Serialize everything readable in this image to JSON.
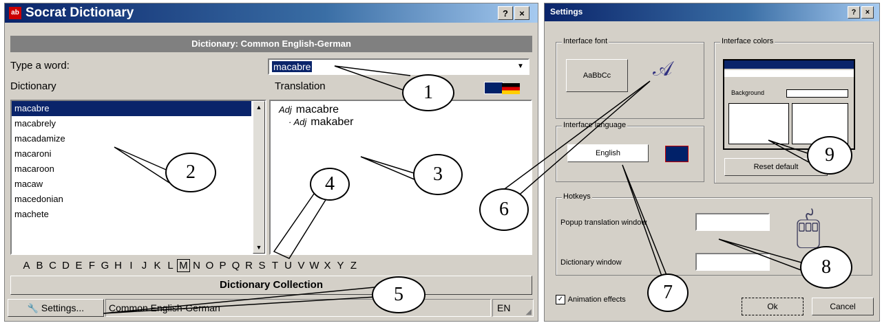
{
  "dictionary_window": {
    "title": "Socrat Dictionary",
    "help_button": "?",
    "close_button": "×",
    "header": "Dictionary: Common English-German",
    "type_word_label": "Type a word:",
    "word_input_value": "macabre",
    "dictionary_label": "Dictionary",
    "translation_label": "Translation",
    "word_list": [
      "macabre",
      "macabrely",
      "macadamize",
      "macaroni",
      "macaroon",
      "macaw",
      "macedonian",
      "machete"
    ],
    "translation_lines": [
      {
        "pos": "Adj",
        "text": "macabre"
      },
      {
        "pos": "· Adj",
        "text": "makaber"
      }
    ],
    "alphabet": [
      "A",
      "B",
      "C",
      "D",
      "E",
      "F",
      "G",
      "H",
      "I",
      "J",
      "K",
      "L",
      "M",
      "N",
      "O",
      "P",
      "Q",
      "R",
      "S",
      "T",
      "U",
      "V",
      "W",
      "X",
      "Y",
      "Z"
    ],
    "alphabet_selected": "M",
    "collection_button": "Dictionary Collection",
    "settings_button": "Settings...",
    "status_dictionary": "Common English-German",
    "status_lang": "EN"
  },
  "settings_window": {
    "title": "Settings",
    "help_button": "?",
    "close_button": "×",
    "interface_font_label": "Interface font",
    "font_sample": "AaBbCc",
    "interface_colors_label": "Interface colors",
    "colors_preview_background": "Background",
    "reset_button": "Reset default",
    "interface_language_label": "Interface language",
    "language_value": "English",
    "hotkeys_label": "Hotkeys",
    "popup_window_label": "Popup translation window",
    "dictionary_window_label": "Dictionary window",
    "animation_label": "Animation effects",
    "animation_checked": true,
    "ok_button": "Ok",
    "cancel_button": "Cancel"
  },
  "callouts": [
    "1",
    "2",
    "3",
    "4",
    "5",
    "6",
    "7",
    "8",
    "9"
  ],
  "colors": {
    "titlebar_start": "#0a246a",
    "titlebar_end": "#a6caf0",
    "selection": "#0a246a",
    "window_face": "#d4d0c8",
    "header_bar": "#808080"
  }
}
